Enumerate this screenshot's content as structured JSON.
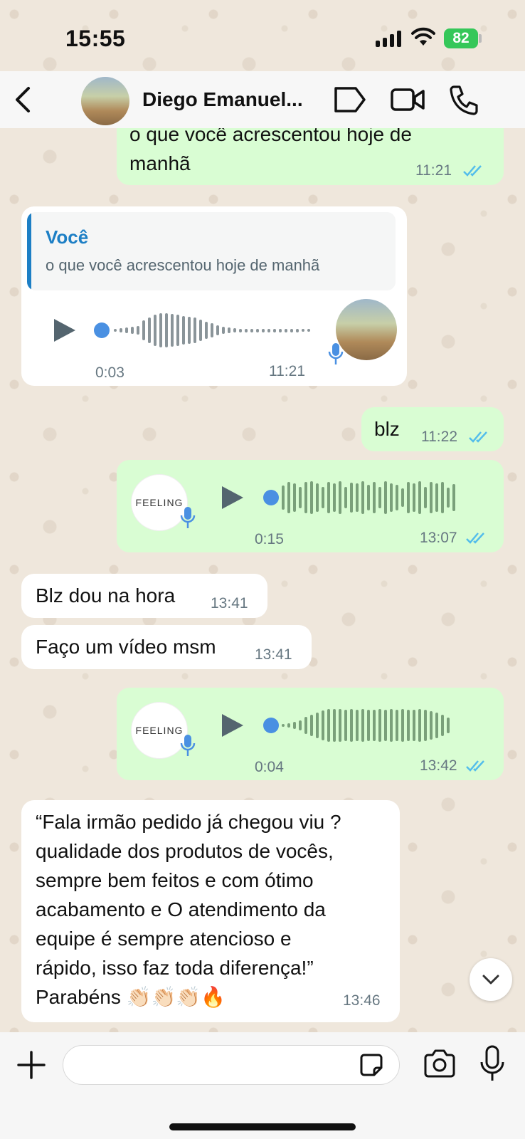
{
  "status_bar": {
    "time": "15:55",
    "battery": "82"
  },
  "header": {
    "contact_name": "Diego Emanuel..."
  },
  "messages": {
    "m1": {
      "text_line1": "o que você acrescentou hoje de",
      "text_line2": "manhã",
      "time": "11:21"
    },
    "m2": {
      "quote_author": "Você",
      "quote_text": "o que você acrescentou hoje de manhã",
      "duration": "0:03",
      "time": "11:21"
    },
    "m3": {
      "text": "blz",
      "time": "11:22"
    },
    "m4": {
      "avatar_text": "FEELING",
      "duration": "0:15",
      "time": "13:07"
    },
    "m5": {
      "text": "Blz dou na hora",
      "time": "13:41"
    },
    "m6": {
      "text": "Faço um vídeo msm",
      "time": "13:41"
    },
    "m7": {
      "avatar_text": "FEELING",
      "duration": "0:04",
      "time": "13:42"
    },
    "m8": {
      "lines": [
        "“Fala irmão pedido já chegou viu ?",
        "qualidade dos produtos de vocês,",
        "sempre bem feitos e com ótimo",
        "acabamento e O atendimento da",
        "equipe é sempre atencioso e",
        "rápido, isso faz toda diferença!”",
        "Parabéns 👏🏻👏🏻👏🏻🔥"
      ],
      "time": "13:46"
    }
  },
  "input": {
    "placeholder": ""
  },
  "colors": {
    "outgoing": "#d9fdd3",
    "incoming": "#ffffff",
    "read_ticks": "#53bdeb",
    "accent": "#1d7fc5"
  }
}
